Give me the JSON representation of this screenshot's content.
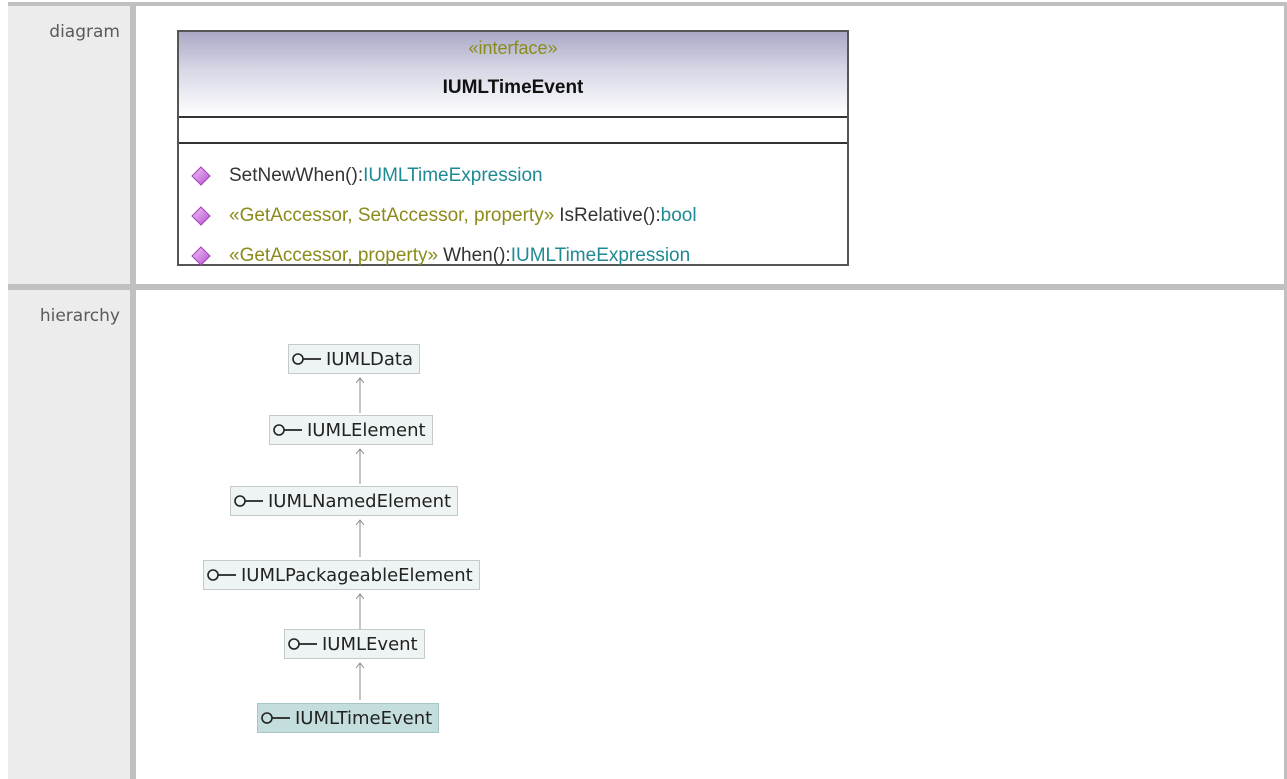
{
  "rows": {
    "diagram_label": "diagram",
    "hierarchy_label": "hierarchy"
  },
  "uml_class": {
    "stereotype": "«interface»",
    "name": "IUMLTimeEvent",
    "operations": [
      {
        "stereotype": "",
        "name": "SetNewWhen():",
        "type": "IUMLTimeExpression"
      },
      {
        "stereotype": "«GetAccessor, SetAccessor, property»",
        "name": "IsRelative():",
        "type": "bool"
      },
      {
        "stereotype": "«GetAccessor, property»",
        "name": "When():",
        "type": "IUMLTimeExpression"
      }
    ]
  },
  "hierarchy": [
    {
      "label": "IUMLData",
      "current": false
    },
    {
      "label": "IUMLElement",
      "current": false
    },
    {
      "label": "IUMLNamedElement",
      "current": false
    },
    {
      "label": "IUMLPackageableElement",
      "current": false
    },
    {
      "label": "IUMLEvent",
      "current": false
    },
    {
      "label": "IUMLTimeEvent",
      "current": true
    }
  ],
  "colors": {
    "stereotype_text": "#8b8b1c",
    "type_text": "#1f8a93",
    "operation_icon": "#cc66dd",
    "current_node_bg": "#c4dede"
  },
  "icons": {
    "operation": "public-operation-diamond-icon",
    "interface": "interface-lollipop-icon"
  }
}
